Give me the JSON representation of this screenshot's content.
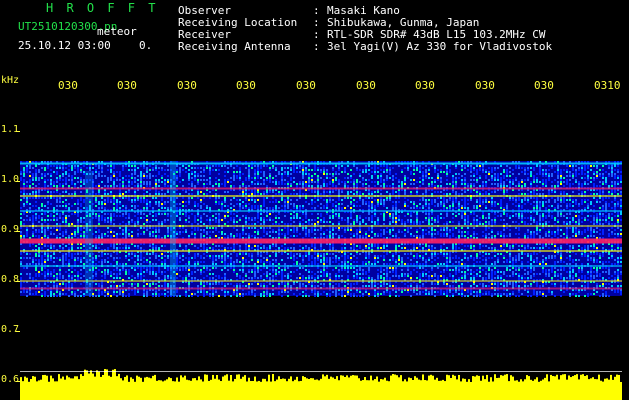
{
  "header": {
    "app_title": "H R O F F T",
    "filename": "UT2510120300.pn",
    "meteor_label": "meteor",
    "datetime": "25.10.12 03:00",
    "count": "0."
  },
  "info": [
    {
      "label": "Observer",
      "value": "Masaki Kano"
    },
    {
      "label": "Receiving Location",
      "value": "Shibukawa, Gunma, Japan"
    },
    {
      "label": "Receiver",
      "value": "RTL-SDR SDR# 43dB L15 103.2MHz CW"
    },
    {
      "label": "Receiving Antenna",
      "value": "3el Yagi(V) Az 330 for Vladivostok"
    }
  ],
  "chart_data": {
    "type": "heatmap",
    "ylabel": "kHz",
    "y_ticks": [
      "1.1",
      "1.0",
      "0.9",
      "0.8",
      "0.7",
      "0.6"
    ],
    "x_ticks": [
      "030",
      "030",
      "030",
      "030",
      "030",
      "030",
      "030",
      "030",
      "030",
      "0310"
    ],
    "signal_band_khz": [
      0.77,
      1.04
    ],
    "strong_line_khz": 0.88,
    "colors": {
      "text_green": "#22e04a",
      "text_white": "#ffffff",
      "tick_yellow": "#ffff40",
      "power_trace": "#ffff00",
      "background": "#000000",
      "low": "#0000a0",
      "mid": "#00c8ff",
      "high": "#ffff00",
      "peak": "#ff2060"
    }
  }
}
